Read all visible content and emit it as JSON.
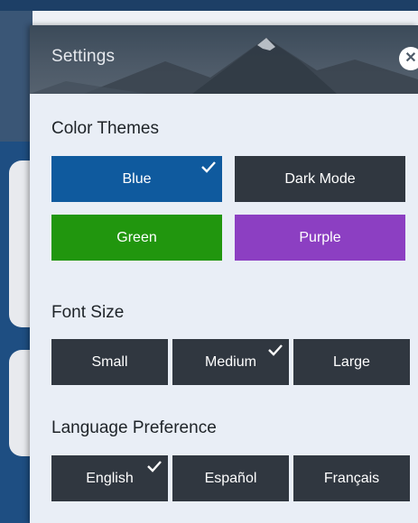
{
  "panel": {
    "title": "Settings",
    "close_icon": "close-icon"
  },
  "color_themes": {
    "title": "Color Themes",
    "options": [
      {
        "label": "Blue",
        "selected": true,
        "color": "#0f5a9e"
      },
      {
        "label": "Dark Mode",
        "selected": false,
        "color": "#303740"
      },
      {
        "label": "Green",
        "selected": false,
        "color": "#21960e"
      },
      {
        "label": "Purple",
        "selected": false,
        "color": "#8c3fc2"
      }
    ]
  },
  "font_size": {
    "title": "Font Size",
    "options": [
      {
        "label": "Small",
        "selected": false
      },
      {
        "label": "Medium",
        "selected": true
      },
      {
        "label": "Large",
        "selected": false
      }
    ]
  },
  "language": {
    "title": "Language Preference",
    "options": [
      {
        "label": "English",
        "selected": true
      },
      {
        "label": "Español",
        "selected": false
      },
      {
        "label": "Français",
        "selected": false
      }
    ]
  },
  "colors": {
    "header_bg": "#4d5a68",
    "panel_bg": "#e9eef6",
    "button_dark": "#303740",
    "selected_check": "#ffffff"
  }
}
